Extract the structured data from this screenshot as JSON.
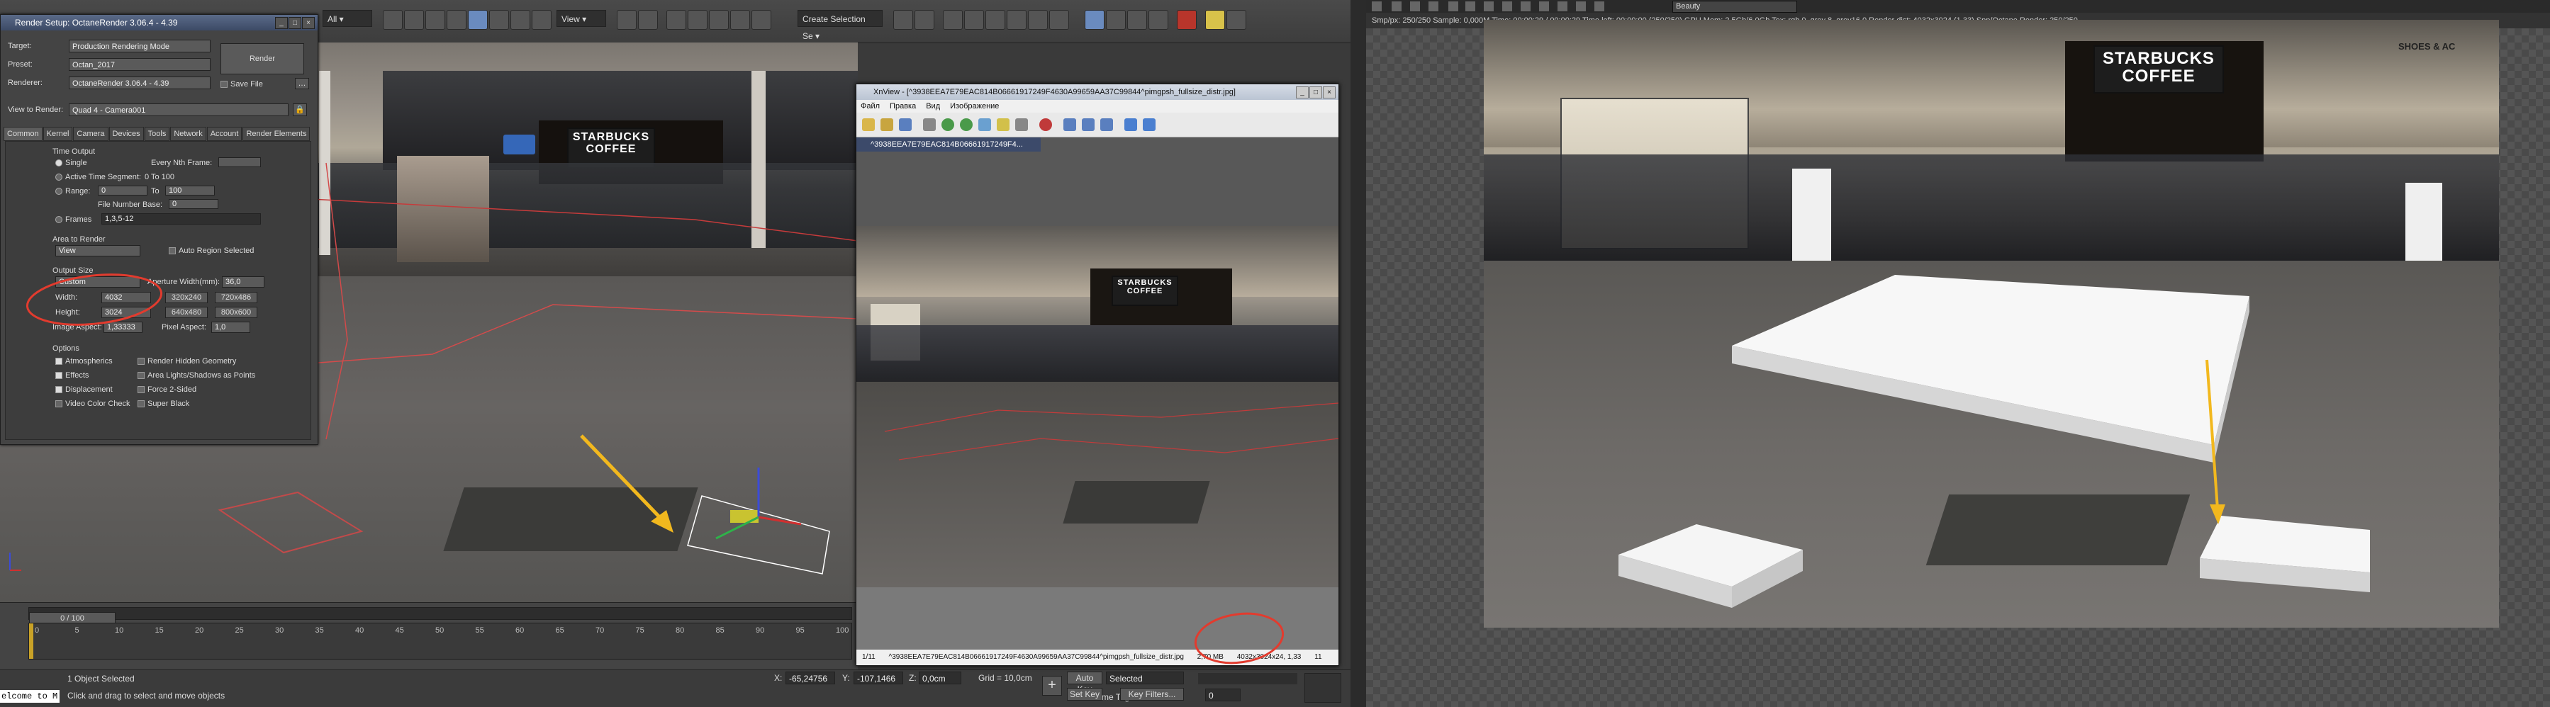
{
  "render_setup": {
    "window_title": "Render Setup: OctaneRender 3.06.4 - 4.39",
    "target_label": "Target:",
    "target_value": "Production Rendering Mode",
    "preset_label": "Preset:",
    "preset_value": "Octan_2017",
    "renderer_label": "Renderer:",
    "renderer_value": "OctaneRender 3.06.4 - 4.39",
    "render_button": "Render",
    "save_file_label": "Save File",
    "view_to_render_label": "View to Render:",
    "view_to_render_value": "Quad 4 - Camera001",
    "tabs": [
      "Common",
      "Kernel",
      "Camera",
      "Devices",
      "Tools",
      "Network",
      "Account",
      "Render Elements"
    ],
    "time_output": {
      "label": "Time Output",
      "single": "Single",
      "every_nth": "Every Nth Frame:",
      "active_segment": "Active Time Segment:",
      "active_segment_value": "0 To 100",
      "range": "Range:",
      "range_from": "0",
      "range_to_label": "To",
      "range_to": "100",
      "file_number_base": "File Number Base:",
      "file_number_base_value": "0",
      "frames": "Frames",
      "frames_value": "1,3,5-12"
    },
    "area_to_render": {
      "label": "Area to Render",
      "value": "View",
      "auto_region": "Auto Region Selected"
    },
    "output_size": {
      "label": "Output Size",
      "preset_value": "Custom",
      "aperture_label": "Aperture Width(mm):",
      "aperture_value": "36,0",
      "width_label": "Width:",
      "width_value": "4032",
      "height_label": "Height:",
      "height_value": "3024",
      "preset_buttons": [
        "320x240",
        "720x486",
        "640x480",
        "800x600"
      ],
      "image_aspect_label": "Image Aspect:",
      "image_aspect_value": "1,33333",
      "pixel_aspect_label": "Pixel Aspect:",
      "pixel_aspect_value": "1,0"
    },
    "options": {
      "label": "Options",
      "left": [
        "Atmospherics",
        "Effects",
        "Displacement",
        "Video Color Check"
      ],
      "right": [
        "Render Hidden Geometry",
        "Area Lights/Shadows as Points",
        "Force 2-Sided",
        "Super Black"
      ]
    }
  },
  "max": {
    "toolbar_dropdown_all": "All",
    "toolbar_dropdown_view": "View",
    "selection_set": "Create Selection Se",
    "timeline_slider": "0 / 100",
    "ruler_ticks": [
      "0",
      "5",
      "10",
      "15",
      "20",
      "25",
      "30",
      "35",
      "40",
      "45",
      "50",
      "55",
      "60",
      "65",
      "70",
      "75",
      "80",
      "85",
      "90",
      "95",
      "100"
    ],
    "status_selected": "1 Object Selected",
    "status_hint": "Click and drag to select and move objects",
    "welcome": "elcome to M",
    "coord_x_label": "X:",
    "coord_x": "-65,24756",
    "coord_y_label": "Y:",
    "coord_y": "-107,1466",
    "coord_z_label": "Z:",
    "coord_z": "0,0cm",
    "grid": "Grid = 10,0cm",
    "add_time_tag": "Add Time Tag",
    "auto_key": "Auto Key",
    "selected_dropdown": "Selected",
    "set_key": "Set Key",
    "key_filters": "Key Filters...",
    "frame_value": "0",
    "viewport_sign_1": "STARBUCKS",
    "viewport_sign_2": "COFFEE"
  },
  "frame_viewer": {
    "title": "XnView - [^3938EEA7E79EAC814B06661917249F4630A99659AA37C99844^pimgpsh_fullsize_distr.jpg]",
    "menu": [
      "Файл",
      "Правка",
      "Вид",
      "Изображение"
    ],
    "tab": "^3938EEA7E79EAC814B06661917249F4...",
    "status_index": "1/11",
    "status_file": "^3938EEA7E79EAC814B06661917249F4630A99659AA37C99844^pimgpsh_fullsize_distr.jpg",
    "status_size": "2,70 MB",
    "status_dims": "4032x3024x24, 1,33",
    "status_zoom": "11"
  },
  "octane": {
    "toolbar_dropdown": "Beauty",
    "info_line": "Smp/px: 250/250    Sample: 0,000M    Time: 00:00:29 / 00:00:29    Time left: 00:00:00 (250/250)    GPU Mem: 2,5Gb/6,0Gb    Tex: rgb 0, grey 8, grey16 0    Render dist: 4032x3024 (1,33)    Spp/Octane Render: 250/250",
    "sign_1": "STARBUCKS",
    "sign_2": "COFFEE",
    "shop_text": "SHOES & AC"
  },
  "colors": {
    "accent_yellow": "#f2b81e",
    "red_annotation": "#e23b2e",
    "title_bar": "#3c4a66"
  }
}
